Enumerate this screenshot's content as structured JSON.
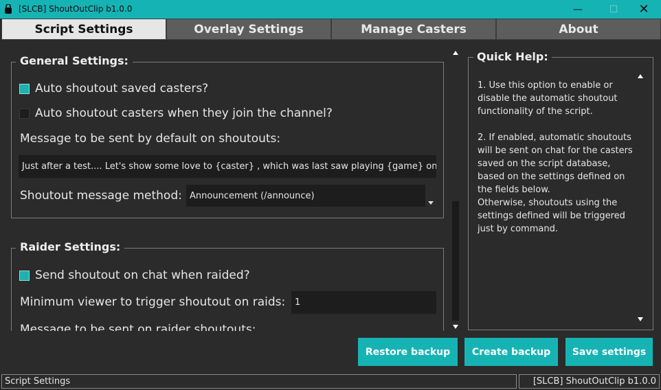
{
  "window": {
    "title": "[SLCB] ShoutOutClip b1.0.0",
    "minimize": "—",
    "maximize": "☐",
    "close": "✕",
    "accent_color": "#16b3b4"
  },
  "tabs": [
    {
      "label": "Script Settings",
      "active": true
    },
    {
      "label": "Overlay Settings",
      "active": false
    },
    {
      "label": "Manage Casters",
      "active": false
    },
    {
      "label": "About",
      "active": false
    }
  ],
  "general": {
    "title": "General Settings:",
    "auto_saved": {
      "label": "Auto shoutout saved casters?",
      "checked": true
    },
    "auto_join": {
      "label": "Auto shoutout casters when they join the channel?",
      "checked": false
    },
    "message_label": "Message to be sent by default on shoutouts:",
    "message_value": "Just after a test.... Let's show some love to {caster} , which was last saw playing {game} on {",
    "method_label": "Shoutout message method:",
    "method_value": "Announcement (/announce)"
  },
  "raider": {
    "title": "Raider Settings:",
    "send_on_raid": {
      "label": "Send shoutout on chat when raided?",
      "checked": true
    },
    "min_viewer_label": "Minimum viewer to trigger shoutout on raids:",
    "min_viewer_value": "1",
    "message_label": "Message to be sent on raider shoutouts:"
  },
  "quick_help": {
    "title": "Quick Help:",
    "text": "1. Use this option to enable or disable the automatic shoutout functionality of the script.\n\n2. If enabled, automatic shoutouts will be sent on chat for the casters saved on the script database, based on the settings defined on the fields below.\nOtherwise, shoutouts using the settings defined will be triggered just by command."
  },
  "buttons": {
    "restore": "Restore backup",
    "create": "Create backup",
    "save": "Save settings"
  },
  "status": {
    "left": "Script Settings",
    "right": "[SLCB] ShoutOutClip b1.0.0"
  }
}
